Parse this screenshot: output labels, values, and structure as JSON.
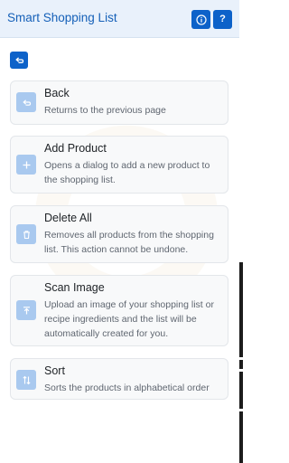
{
  "header": {
    "title": "Smart Shopping List",
    "info_icon": "info-circle-icon",
    "help_label": "?"
  },
  "toolbar": {
    "back_icon": "back-arrow-icon"
  },
  "cards": [
    {
      "title": "Back",
      "description": "Returns to the previous page",
      "icon": "back-arrow-icon"
    },
    {
      "title": "Add Product",
      "description": "Opens a dialog to add a new product to the shopping list.",
      "icon": "plus-icon"
    },
    {
      "title": "Delete All",
      "description": "Removes all products from the shopping list. This action cannot be undone.",
      "icon": "trash-icon"
    },
    {
      "title": "Scan Image",
      "description": "Upload an image of your shopping list or recipe ingredients and the list will be automatically created for you.",
      "icon": "upload-icon"
    },
    {
      "title": "Sort",
      "description": "Sorts the products in alphabetical order",
      "icon": "sort-arrows-icon"
    }
  ],
  "colors": {
    "primary": "#0d62c9",
    "header_bg": "#e9f1fb",
    "title_color": "#1560b8",
    "card_bg": "#f8f9fa",
    "card_icon_bg": "#a9c9ef",
    "text": "#212529",
    "muted": "#5f6670"
  }
}
